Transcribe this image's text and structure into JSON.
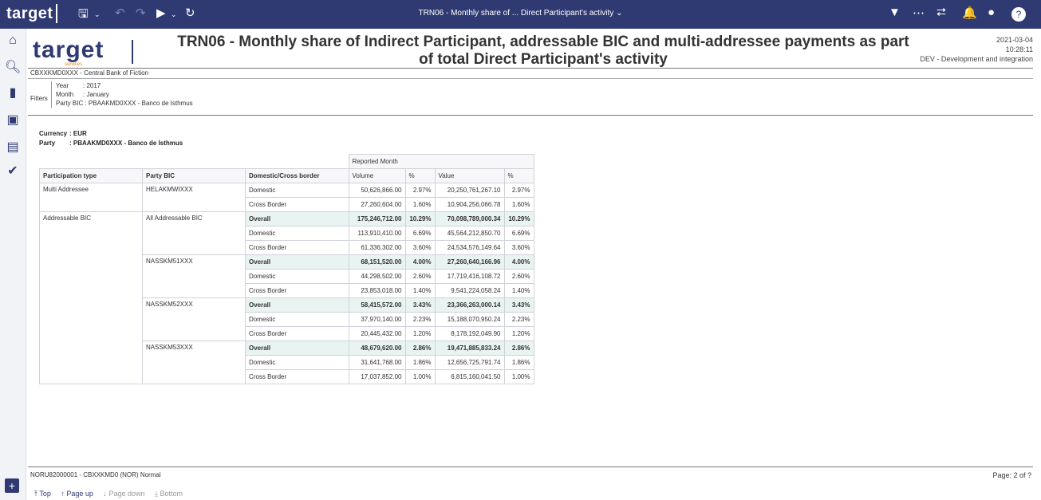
{
  "app": {
    "logo": "target",
    "report_menu_title": "TRN06 - Monthly share of ... Direct Participant's activity",
    "brand_sub": "services"
  },
  "toolbar": {
    "icons": [
      "save-icon",
      "undo-icon",
      "redo-icon",
      "run-icon",
      "refresh-icon",
      "filter-icon",
      "more-icon",
      "share-icon",
      "bell-icon",
      "user-icon",
      "help-icon"
    ],
    "accent": "#2f3a73"
  },
  "sidebar": {
    "icons": [
      "home-icon",
      "search-icon",
      "document-icon",
      "folder-icon",
      "team-folder-icon",
      "check-icon",
      "add-icon"
    ]
  },
  "report": {
    "title": "TRN06 - Monthly share of Indirect Participant, addressable BIC and multi-addressee payments as part of total Direct Participant's activity",
    "date": "2021-03-04",
    "time": "10:28:11",
    "environment": "DEV - Development and integration",
    "bank": "CBXXKMD0XXX - Central Bank of Fiction",
    "filters_label": "Filters",
    "filters": [
      {
        "key": "Year",
        "value": ": 2017"
      },
      {
        "key": "Month",
        "value": ": January"
      },
      {
        "key": "Party BIC",
        "value": ": PBAAKMD0XXX - Banco de Isthmus"
      }
    ],
    "currency_label": "Currency",
    "currency": ": EUR",
    "party_label": "Party",
    "party": ": PBAAKMD0XXX - Banco de Isthmus"
  },
  "table": {
    "group_header": "Reported Month",
    "headers": [
      "Participation type",
      "Party BIC",
      "Domestic/Cross border",
      "Volume",
      "%",
      "Value",
      "%"
    ],
    "groups": [
      {
        "type": "Multi Addressee",
        "bic": "HELAKMWIXXX",
        "rows": [
          {
            "kind": "Domestic",
            "volume": "50,626,866.00",
            "vpct": "2.97%",
            "value": "20,250,761,267.10",
            "valpct": "2.97%"
          },
          {
            "kind": "Cross Border",
            "volume": "27,260,604.00",
            "vpct": "1.60%",
            "value": "10,904,256,066.78",
            "valpct": "1.60%"
          }
        ]
      },
      {
        "type": "Addressable BIC",
        "bic": "All Addressable BIC",
        "rows": [
          {
            "kind": "Overall",
            "volume": "175,246,712.00",
            "vpct": "10.29%",
            "value": "70,098,789,000.34",
            "valpct": "10.29%"
          },
          {
            "kind": "Domestic",
            "volume": "113,910,410.00",
            "vpct": "6.69%",
            "value": "45,564,212,850.70",
            "valpct": "6.69%"
          },
          {
            "kind": "Cross Border",
            "volume": "61,336,302.00",
            "vpct": "3.60%",
            "value": "24,534,576,149.64",
            "valpct": "3.60%"
          }
        ]
      },
      {
        "type": "",
        "bic": "NASSKM51XXX",
        "rows": [
          {
            "kind": "Overall",
            "volume": "68,151,520.00",
            "vpct": "4.00%",
            "value": "27,260,640,166.96",
            "valpct": "4.00%"
          },
          {
            "kind": "Domestic",
            "volume": "44,298,502.00",
            "vpct": "2.60%",
            "value": "17,719,416,108.72",
            "valpct": "2.60%"
          },
          {
            "kind": "Cross Border",
            "volume": "23,853,018.00",
            "vpct": "1.40%",
            "value": "9,541,224,058.24",
            "valpct": "1.40%"
          }
        ]
      },
      {
        "type": "",
        "bic": "NASSKM52XXX",
        "rows": [
          {
            "kind": "Overall",
            "volume": "58,415,572.00",
            "vpct": "3.43%",
            "value": "23,366,263,000.14",
            "valpct": "3.43%"
          },
          {
            "kind": "Domestic",
            "volume": "37,970,140.00",
            "vpct": "2.23%",
            "value": "15,188,070,950.24",
            "valpct": "2.23%"
          },
          {
            "kind": "Cross Border",
            "volume": "20,445,432.00",
            "vpct": "1.20%",
            "value": "8,178,192,049.90",
            "valpct": "1.20%"
          }
        ]
      },
      {
        "type": "",
        "bic": "NASSKM53XXX",
        "rows": [
          {
            "kind": "Overall",
            "volume": "48,679,620.00",
            "vpct": "2.86%",
            "value": "19,471,885,833.24",
            "valpct": "2.86%"
          },
          {
            "kind": "Domestic",
            "volume": "31,641,768.00",
            "vpct": "1.86%",
            "value": "12,656,725,791.74",
            "valpct": "1.86%"
          },
          {
            "kind": "Cross Border",
            "volume": "17,037,852.00",
            "vpct": "1.00%",
            "value": "6,815,160,041.50",
            "valpct": "1.00%"
          }
        ]
      }
    ]
  },
  "footer": {
    "text": "NORU82000001 - CBXXKMD0 (NOR) Normal",
    "page": "Page: 2 of ?"
  },
  "nav": {
    "top": "Top",
    "page_up": "Page up",
    "page_down": "Page down",
    "bottom": "Bottom"
  }
}
